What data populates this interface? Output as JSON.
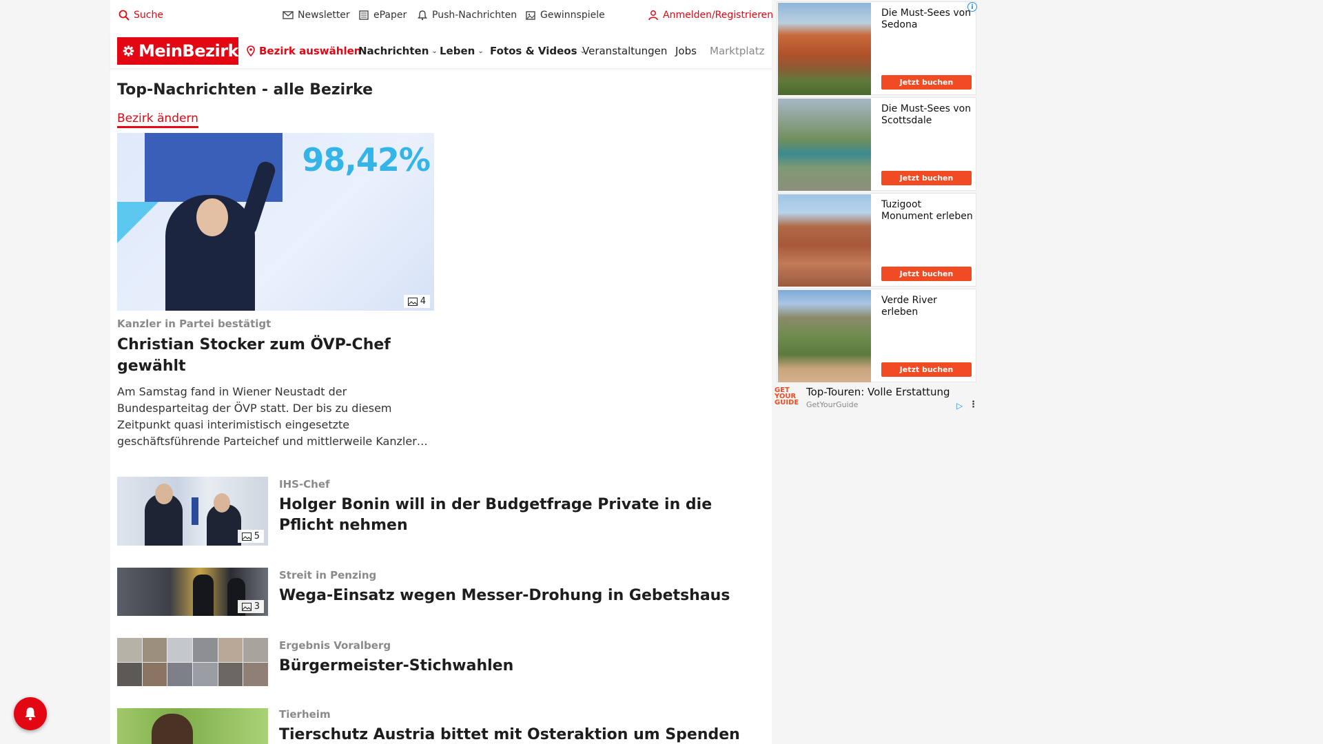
{
  "topbar": {
    "search": "Suche",
    "newsletter": "Newsletter",
    "epaper": "ePaper",
    "push": "Push-Nachrichten",
    "gewinnspiele": "Gewinnspiele",
    "login": "Anmelden/Registrieren"
  },
  "nav": {
    "logo": "MeinBezirk",
    "bezirk": "Bezirk auswählen",
    "items": [
      "Nachrichten",
      "Leben",
      "Fotos & Videos",
      "Veranstaltungen",
      "Jobs",
      "Marktplatz"
    ]
  },
  "page": {
    "title": "Top-Nachrichten - alle Bezirke",
    "change_bezirk": "Bezirk ändern"
  },
  "hero": {
    "image_text": "98,42%",
    "image_count": "4",
    "kicker": "Kanzler in Partei bestätigt",
    "headline": "Christian Stocker zum ÖVP-Chef gewählt",
    "teaser": "Am Samstag fand in Wiener Neustadt der Bundesparteitag der ÖVP statt. Der bis zu diesem Zeitpunkt quasi interimistisch eingesetzte geschäftsführende Parteichef und mittlerweile Kanzler…"
  },
  "stories": [
    {
      "kicker": "IHS-Chef",
      "headline": "Holger Bonin will in der Budgetfrage Private in die Pflicht nehmen",
      "image_count": "5"
    },
    {
      "kicker": "Streit in Penzing",
      "headline": "Wega-Einsatz wegen Messer-Drohung in Gebetshaus",
      "image_count": "3"
    },
    {
      "kicker": "Ergebnis Voralberg",
      "headline": "Bürgermeister-Stichwahlen",
      "image_count": ""
    },
    {
      "kicker": "Tierheim",
      "headline": "Tierschutz Austria bittet mit Osteraktion um Spenden",
      "image_count": ""
    }
  ],
  "ads": {
    "info": "i",
    "cards": [
      {
        "title": "Die Must-Sees von Sedona",
        "button": "Jetzt buchen"
      },
      {
        "title": "Die Must-Sees von Scottsdale",
        "button": "Jetzt buchen"
      },
      {
        "title": "Tuzigoot Monument erleben",
        "button": "Jetzt buchen"
      },
      {
        "title": "Verde River erleben",
        "button": "Jetzt buchen"
      }
    ],
    "footer": {
      "logo": "GET YOUR GUIDE",
      "title": "Top-Touren: Volle Erstattung",
      "source": "GetYourGuide"
    }
  },
  "colors": {
    "brand": "#e30613",
    "ad_button": "#f04b23",
    "kicker_gray": "#8a8a8a"
  }
}
